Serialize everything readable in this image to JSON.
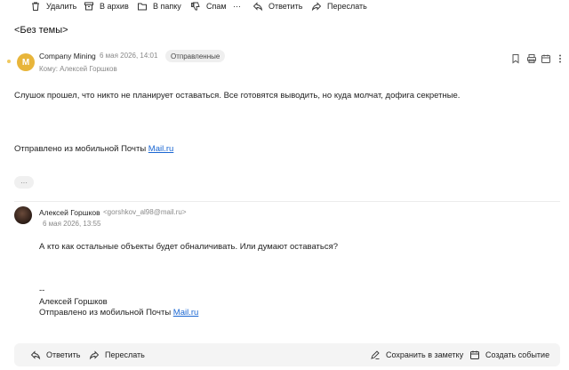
{
  "toolbar": {
    "delete_label": "Удалить",
    "archive_label": "В архив",
    "folder_label": "В папку",
    "spam_label": "Спам",
    "more_label": "···",
    "reply_label": "Ответить",
    "forward_label": "Переслать"
  },
  "message": {
    "subject": "<Без темы>",
    "avatar_letter": "M",
    "sender": "Company Mining",
    "date": "6 мая 2026, 14:01",
    "status_badge": "Отправленные",
    "to_line": "Кому: Алексей Горшков",
    "body": "Слушок прошел, что никто не планирует оставаться. Все готовятся выводить, но куда молчат, дофига секретные.",
    "signature_prefix": "Отправлено из мобильной Почты ",
    "signature_link": "Mail.ru",
    "collapsed_label": "···"
  },
  "reply": {
    "sender": "Алексей Горшков",
    "email": "<gorshkov_al98@mail.ru>",
    "date": "6 мая 2026, 13:55",
    "body": "А кто как остальные объекты будет обналичивать. Или думают оставаться?",
    "sig_dash": "--",
    "sig_name": "Алексей Горшков",
    "sig_prefix": "Отправлено из мобильной Почты ",
    "sig_link": "Mail.ru"
  },
  "bottom_bar": {
    "reply_label": "Ответить",
    "forward_label": "Переслать",
    "note_label": "Сохранить в заметку",
    "event_label": "Создать событие"
  },
  "colors": {
    "link": "#1a66d2",
    "avatar": "#e8b53a"
  }
}
